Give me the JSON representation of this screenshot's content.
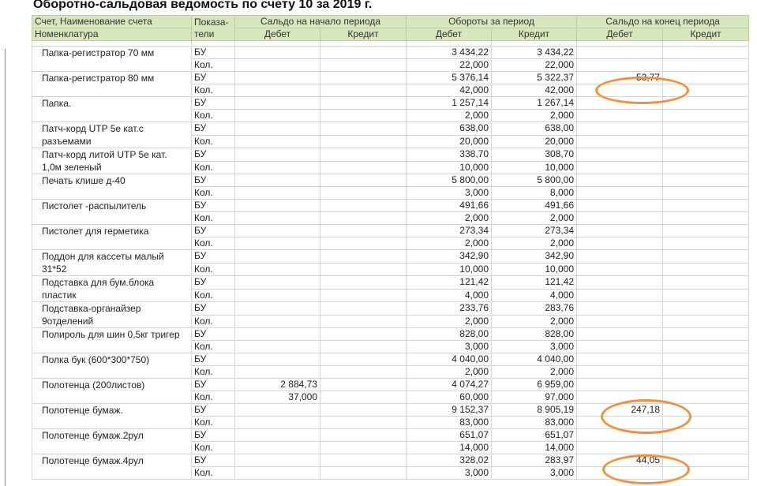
{
  "title": "Оборотно-сальдовая ведомость по счету 10 за 2019 г.",
  "header": {
    "account_name": "Счет, Наименование счета",
    "nomenclature": "Номенклатура",
    "indicators": "Показа-тели",
    "opening_balance": "Сальдо на начало периода",
    "turnover": "Обороты за период",
    "closing_balance": "Сальдо на конец периода",
    "debit": "Дебет",
    "credit": "Кредит"
  },
  "rows": [
    {
      "name": "Папка-регистратор 70 мм",
      "bu": {
        "ind": "БУ",
        "od": "",
        "oc": "",
        "td": "3 434,22",
        "tc": "3 434,22",
        "cd": "",
        "cc": ""
      },
      "kol": {
        "ind": "Кол.",
        "od": "",
        "oc": "",
        "td": "22,000",
        "tc": "22,000",
        "cd": "",
        "cc": ""
      }
    },
    {
      "name": "Папка-регистратор 80 мм",
      "bu": {
        "ind": "БУ",
        "od": "",
        "oc": "",
        "td": "5 376,14",
        "tc": "5 322,37",
        "cd": "53,77",
        "cc": ""
      },
      "kol": {
        "ind": "Кол.",
        "od": "",
        "oc": "",
        "td": "42,000",
        "tc": "42,000",
        "cd": "",
        "cc": ""
      }
    },
    {
      "name": "Папка.",
      "bu": {
        "ind": "БУ",
        "od": "",
        "oc": "",
        "td": "1 257,14",
        "tc": "1 267,14",
        "cd": "",
        "cc": ""
      },
      "kol": {
        "ind": "Кол.",
        "od": "",
        "oc": "",
        "td": "2,000",
        "tc": "2,000",
        "cd": "",
        "cc": ""
      }
    },
    {
      "name": "Патч-корд UTP 5е кат.с разъемами",
      "bu": {
        "ind": "БУ",
        "od": "",
        "oc": "",
        "td": "638,00",
        "tc": "638,00",
        "cd": "",
        "cc": ""
      },
      "kol": {
        "ind": "Кол.",
        "od": "",
        "oc": "",
        "td": "20,000",
        "tc": "20,000",
        "cd": "",
        "cc": ""
      }
    },
    {
      "name": "Патч-корд литой UTP 5е кат. 1,0м зеленый",
      "bu": {
        "ind": "БУ",
        "od": "",
        "oc": "",
        "td": "338,70",
        "tc": "308,70",
        "cd": "",
        "cc": ""
      },
      "kol": {
        "ind": "Кол.",
        "od": "",
        "oc": "",
        "td": "10,000",
        "tc": "10,000",
        "cd": "",
        "cc": ""
      }
    },
    {
      "name": "Печать клише д-40",
      "bu": {
        "ind": "БУ",
        "od": "",
        "oc": "",
        "td": "5 800,00",
        "tc": "5 800,00",
        "cd": "",
        "cc": ""
      },
      "kol": {
        "ind": "Кол.",
        "od": "",
        "oc": "",
        "td": "3,000",
        "tc": "8,000",
        "cd": "",
        "cc": ""
      }
    },
    {
      "name": "Пистолет -распылитель",
      "bu": {
        "ind": "БУ",
        "od": "",
        "oc": "",
        "td": "491,66",
        "tc": "491,66",
        "cd": "",
        "cc": ""
      },
      "kol": {
        "ind": "Кол.",
        "od": "",
        "oc": "",
        "td": "2,000",
        "tc": "2,000",
        "cd": "",
        "cc": ""
      }
    },
    {
      "name": "Пистолет для герметика",
      "bu": {
        "ind": "БУ",
        "od": "",
        "oc": "",
        "td": "273,34",
        "tc": "273,34",
        "cd": "",
        "cc": ""
      },
      "kol": {
        "ind": "Кол.",
        "od": "",
        "oc": "",
        "td": "2,000",
        "tc": "2,000",
        "cd": "",
        "cc": ""
      }
    },
    {
      "name": "Поддон для кассеты малый 31*52",
      "bu": {
        "ind": "БУ",
        "od": "",
        "oc": "",
        "td": "342,90",
        "tc": "342,90",
        "cd": "",
        "cc": ""
      },
      "kol": {
        "ind": "Кол.",
        "od": "",
        "oc": "",
        "td": "10,000",
        "tc": "10,000",
        "cd": "",
        "cc": ""
      }
    },
    {
      "name": "Подставка для бум.блока пластик",
      "bu": {
        "ind": "БУ",
        "od": "",
        "oc": "",
        "td": "121,42",
        "tc": "121,42",
        "cd": "",
        "cc": ""
      },
      "kol": {
        "ind": "Кол.",
        "od": "",
        "oc": "",
        "td": "4,000",
        "tc": "4,000",
        "cd": "",
        "cc": ""
      }
    },
    {
      "name": "Подставка-органайзер 9отделений",
      "bu": {
        "ind": "БУ",
        "od": "",
        "oc": "",
        "td": "233,76",
        "tc": "283,76",
        "cd": "",
        "cc": ""
      },
      "kol": {
        "ind": "Кол.",
        "od": "",
        "oc": "",
        "td": "2,000",
        "tc": "2,000",
        "cd": "",
        "cc": ""
      }
    },
    {
      "name": "Полироль для шин 0,5кг тригер",
      "bu": {
        "ind": "БУ",
        "od": "",
        "oc": "",
        "td": "828,00",
        "tc": "828,00",
        "cd": "",
        "cc": ""
      },
      "kol": {
        "ind": "Кол.",
        "od": "",
        "oc": "",
        "td": "3,000",
        "tc": "3,000",
        "cd": "",
        "cc": ""
      }
    },
    {
      "name": "Полка бук (600*300*750)",
      "bu": {
        "ind": "БУ",
        "od": "",
        "oc": "",
        "td": "4 040,00",
        "tc": "4 040,00",
        "cd": "",
        "cc": ""
      },
      "kol": {
        "ind": "Кол.",
        "od": "",
        "oc": "",
        "td": "2,000",
        "tc": "2,000",
        "cd": "",
        "cc": ""
      }
    },
    {
      "name": "Полотенца (200листов)",
      "bu": {
        "ind": "БУ",
        "od": "2 884,73",
        "oc": "",
        "td": "4 074,27",
        "tc": "6 959,00",
        "cd": "",
        "cc": ""
      },
      "kol": {
        "ind": "Кол.",
        "od": "37,000",
        "oc": "",
        "td": "60,000",
        "tc": "97,000",
        "cd": "",
        "cc": ""
      }
    },
    {
      "name": "Полотенце бумаж.",
      "bu": {
        "ind": "БУ",
        "od": "",
        "oc": "",
        "td": "9 152,37",
        "tc": "8 905,19",
        "cd": "247,18",
        "cc": ""
      },
      "kol": {
        "ind": "Кол.",
        "od": "",
        "oc": "",
        "td": "83,000",
        "tc": "83,000",
        "cd": "",
        "cc": ""
      }
    },
    {
      "name": "Полотенце бумаж.2рул",
      "bu": {
        "ind": "БУ",
        "od": "",
        "oc": "",
        "td": "651,07",
        "tc": "651,07",
        "cd": "",
        "cc": ""
      },
      "kol": {
        "ind": "Кол.",
        "od": "",
        "oc": "",
        "td": "14,000",
        "tc": "14,000",
        "cd": "",
        "cc": ""
      }
    },
    {
      "name": "Полотенце бумаж.4рул",
      "bu": {
        "ind": "БУ",
        "od": "",
        "oc": "",
        "td": "328,02",
        "tc": "283,97",
        "cd": "44,05",
        "cc": ""
      },
      "kol": {
        "ind": "Кол.",
        "od": "",
        "oc": "",
        "td": "3,000",
        "tc": "3,000",
        "cd": "",
        "cc": ""
      }
    }
  ],
  "colors": {
    "header_bg": "#d7e7bd",
    "header_border": "#bfcfa5",
    "highlight": "#f2913a"
  }
}
